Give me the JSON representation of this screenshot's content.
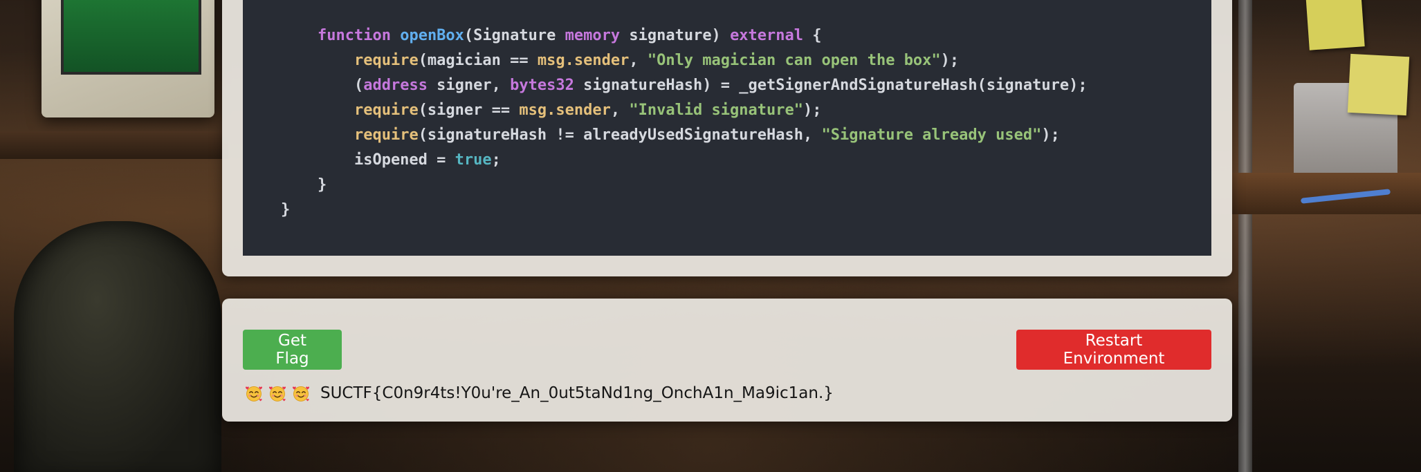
{
  "code": {
    "lines": [
      [
        {
          "t": "    ",
          "c": ""
        },
        {
          "t": "function",
          "c": "kw"
        },
        {
          "t": " ",
          "c": ""
        },
        {
          "t": "openBox",
          "c": "fn"
        },
        {
          "t": "(Signature ",
          "c": ""
        },
        {
          "t": "memory",
          "c": "kw"
        },
        {
          "t": " signature) ",
          "c": ""
        },
        {
          "t": "external",
          "c": "kw"
        },
        {
          "t": " {",
          "c": ""
        }
      ],
      [
        {
          "t": "        ",
          "c": ""
        },
        {
          "t": "require",
          "c": "rq"
        },
        {
          "t": "(magician == ",
          "c": ""
        },
        {
          "t": "msg.sender",
          "c": "msg"
        },
        {
          "t": ", ",
          "c": ""
        },
        {
          "t": "\"Only magician can open the box\"",
          "c": "str"
        },
        {
          "t": ");",
          "c": ""
        }
      ],
      [
        {
          "t": "        (",
          "c": ""
        },
        {
          "t": "address",
          "c": "ty"
        },
        {
          "t": " signer, ",
          "c": ""
        },
        {
          "t": "bytes32",
          "c": "ty"
        },
        {
          "t": " signatureHash) = _getSignerAndSignatureHash(signature);",
          "c": ""
        }
      ],
      [
        {
          "t": "        ",
          "c": ""
        },
        {
          "t": "require",
          "c": "rq"
        },
        {
          "t": "(signer == ",
          "c": ""
        },
        {
          "t": "msg.sender",
          "c": "msg"
        },
        {
          "t": ", ",
          "c": ""
        },
        {
          "t": "\"Invalid signature\"",
          "c": "str"
        },
        {
          "t": ");",
          "c": ""
        }
      ],
      [
        {
          "t": "        ",
          "c": ""
        },
        {
          "t": "require",
          "c": "rq"
        },
        {
          "t": "(signatureHash != alreadyUsedSignatureHash, ",
          "c": ""
        },
        {
          "t": "\"Signature already used\"",
          "c": "str"
        },
        {
          "t": ");",
          "c": ""
        }
      ],
      [
        {
          "t": "        isOpened = ",
          "c": ""
        },
        {
          "t": "true",
          "c": "bool"
        },
        {
          "t": ";",
          "c": ""
        }
      ],
      [
        {
          "t": "    }",
          "c": ""
        }
      ],
      [
        {
          "t": "}",
          "c": ""
        }
      ]
    ]
  },
  "actions": {
    "get_flag_label": "Get Flag",
    "restart_label": "Restart Environment"
  },
  "result": {
    "emojis": [
      "smiling-face-with-hearts-icon",
      "smiling-face-with-hearts-icon",
      "smiling-face-with-hearts-icon"
    ],
    "flag_text": "SUCTF{C0n9r4ts!Y0u're_An_0ut5taNd1ng_OnchA1n_Ma9ic1an.}"
  },
  "colors": {
    "code_background": "#282c34",
    "keyword": "#c678dd",
    "function_name": "#61afef",
    "require": "#e5c07b",
    "string": "#98c379",
    "boolean": "#56b6c2",
    "get_flag_button": "#4cae4f",
    "restart_button": "#e02c2c",
    "card_background": "#ece8e2"
  }
}
